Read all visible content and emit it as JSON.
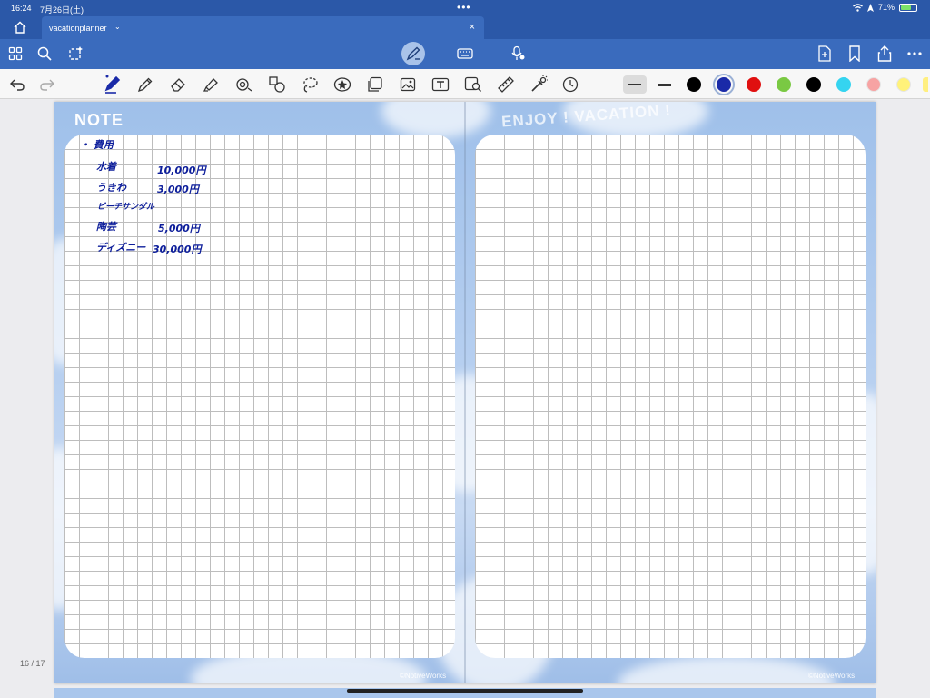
{
  "status": {
    "time": "16:24",
    "date": "7月26日(土)",
    "battery": "71%",
    "battery_level": 0.71
  },
  "tab": {
    "title": "vacationplanner"
  },
  "toolbar1": {
    "left_icons": [
      "grid-icon",
      "search-icon",
      "lasso-sparkle-icon"
    ],
    "center_icons": [
      "pen-mode-icon",
      "keyboard-icon",
      "voice-icon"
    ],
    "right_icons": [
      "add-page-icon",
      "bookmark-icon",
      "share-icon",
      "more-icon"
    ]
  },
  "toolbar2": {
    "tools": [
      "pen-icon",
      "pencil-icon",
      "eraser-icon",
      "highlighter-icon",
      "shape-icon",
      "element-icon",
      "lasso-icon",
      "sticker-icon",
      "sticky-note-icon",
      "image-icon",
      "text-box-icon",
      "image-scan-icon",
      "ruler-icon",
      "laser-pointer-icon",
      "timer-icon"
    ],
    "colors": [
      "#000000",
      "#1a2aa8",
      "#e01010",
      "#7ac943",
      "#000000",
      "#35d4f0",
      "#f7a3a3",
      "#fff27a"
    ],
    "selected_color_index": 1,
    "selected_width_index": 1
  },
  "page": {
    "left_title": "NOTE",
    "right_title": "ENJOY ! VACATION !",
    "credit_left": "©NotiveWorks",
    "credit_right": "©NotiveWorks"
  },
  "handwriting": {
    "heading": "・ 費用",
    "rows": [
      {
        "item": "水着",
        "amount": "10,000円"
      },
      {
        "item": "うきわ",
        "amount": "3,000円"
      },
      {
        "item": "ビーチサンダル",
        "amount": ""
      },
      {
        "item": "陶芸",
        "amount": "5,000円"
      },
      {
        "item": "ディズニー",
        "amount": "30,000円"
      }
    ]
  },
  "page_indicator": "16 / 17"
}
